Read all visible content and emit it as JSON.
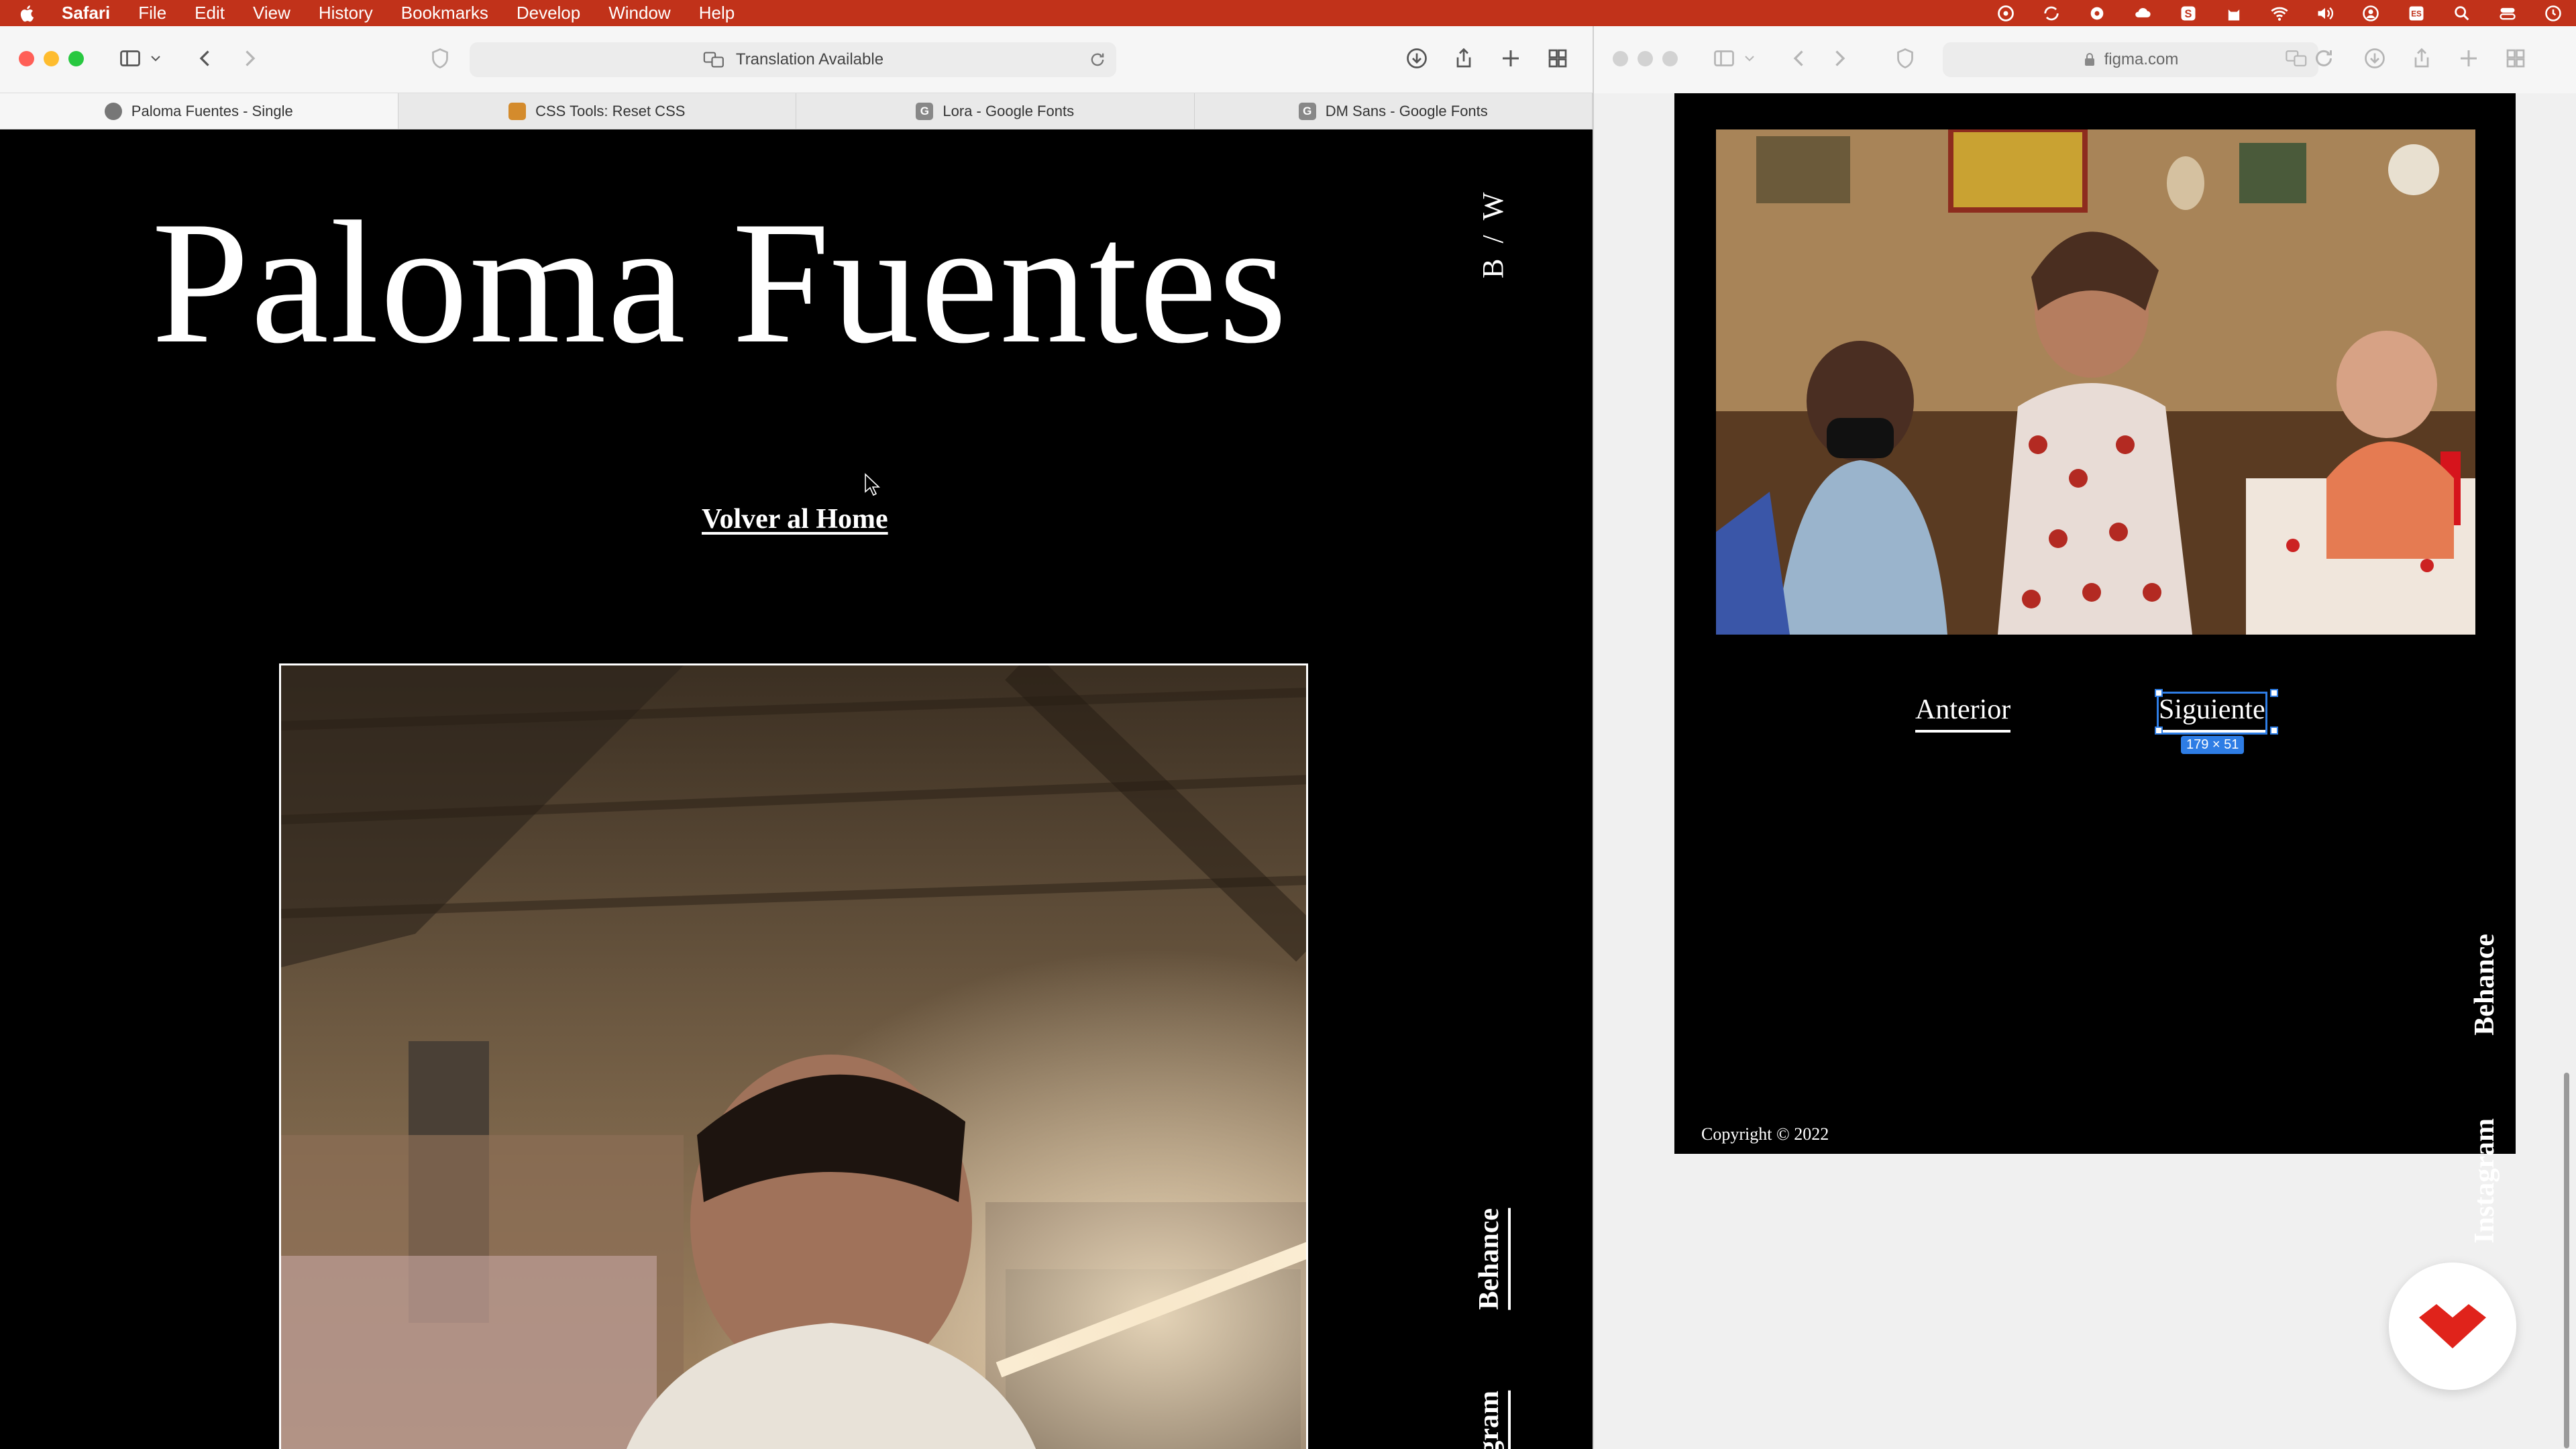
{
  "menubar": {
    "app": "Safari",
    "items": [
      "File",
      "Edit",
      "View",
      "History",
      "Bookmarks",
      "Develop",
      "Window",
      "Help"
    ]
  },
  "left_window": {
    "url_text": "Translation Available",
    "tabs": [
      {
        "label": "Paloma Fuentes - Single",
        "active": true
      },
      {
        "label": "CSS Tools: Reset CSS",
        "active": false
      },
      {
        "label": "Lora - Google Fonts",
        "active": false
      },
      {
        "label": "DM Sans - Google Fonts",
        "active": false
      }
    ],
    "page": {
      "title": "Paloma Fuentes",
      "mode_toggle": "B / W",
      "back_link": "Volver al Home",
      "side_links": [
        "Behance",
        "Instagram"
      ]
    }
  },
  "right_window": {
    "url_text": "figma.com",
    "page": {
      "prev_link": "Anterior",
      "next_link": "Siguiente",
      "selection_size": "179 × 51",
      "side_links": [
        "Behance",
        "Instagram"
      ],
      "copyright": "Copyright © 2022"
    }
  },
  "colors": {
    "menubar": "#c1321a",
    "selection": "#2e7de5",
    "fab_logo": "#e0231b"
  }
}
